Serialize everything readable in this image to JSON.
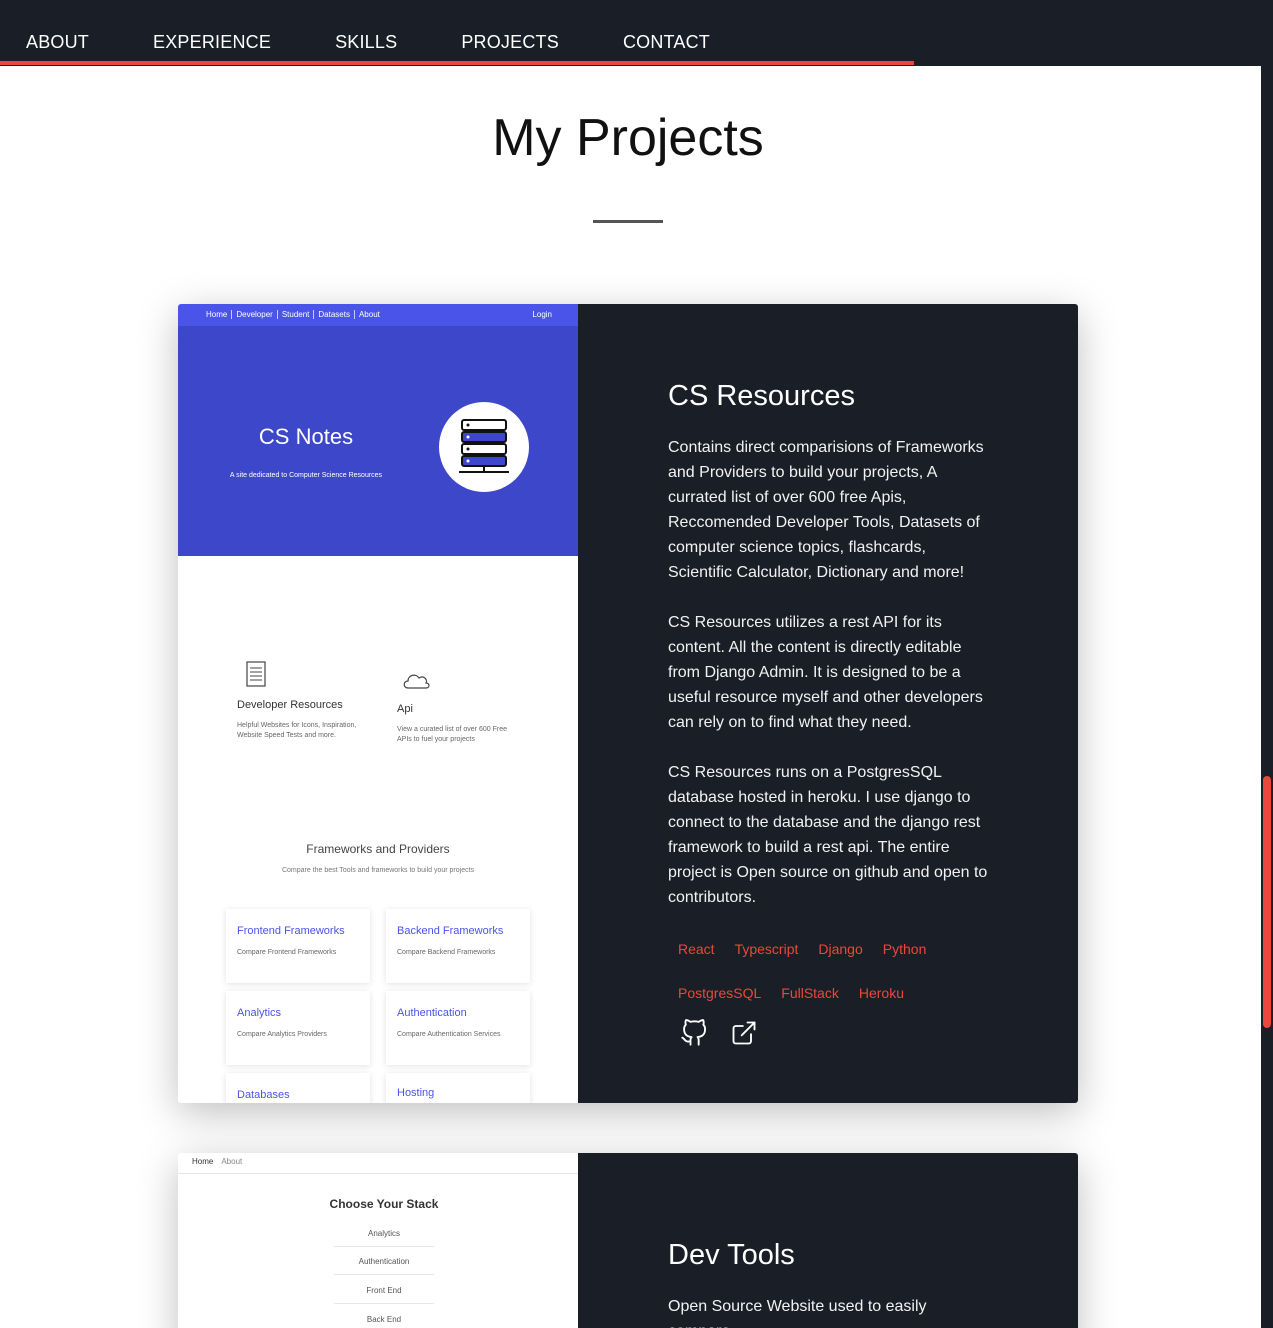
{
  "nav": {
    "links": [
      "ABOUT",
      "EXPERIENCE",
      "SKILLS",
      "PROJECTS",
      "CONTACT"
    ]
  },
  "section": {
    "title": "My Projects"
  },
  "projects": [
    {
      "title": "CS Resources",
      "description": [
        "Contains direct comparisions of Frameworks and Providers to build your projects, A currated list of over 600 free Apis, Reccomended Developer Tools, Datasets of computer science topics, flashcards, Scientific Calculator, Dictionary and more!",
        "CS Resources utilizes a rest API for its content. All the content is directly editable from Django Admin. It is designed to be a useful resource myself and other developers can rely on to find what they need.",
        "CS Resources runs on a PostgresSQL database hosted in heroku. I use django to connect to the database and the django rest framework to build a rest api. The entire project is Open source on github and open to contributors."
      ],
      "tags": [
        "React",
        "Typescript",
        "Django",
        "Python",
        "PostgresSQL",
        "FullStack",
        "Heroku"
      ],
      "icons": [
        "github-icon",
        "external-link-icon"
      ],
      "screenshot": {
        "nav_links": [
          "Home",
          "Developer",
          "Student",
          "Datasets",
          "About"
        ],
        "login": "Login",
        "hero_title": "CS Notes",
        "hero_subtitle": "A site dedicated to Computer Science Resources",
        "features": [
          {
            "title": "Developer Resources",
            "text": "Helpful Websites for Icons, Inspiration, Website Speed Tests and more."
          },
          {
            "title": "Api",
            "text": "View a curated list of over 600 Free APIs to fuel your projects"
          }
        ],
        "fw_title": "Frameworks and Providers",
        "fw_subtitle": "Compare the best Tools and frameworks to build your projects",
        "boxes": [
          {
            "title": "Frontend Frameworks",
            "text": "Compare Frontend Frameworks"
          },
          {
            "title": "Backend Frameworks",
            "text": "Compare Backend Frameworks"
          },
          {
            "title": "Analytics",
            "text": "Compare Analytics Providers"
          },
          {
            "title": "Authentication",
            "text": "Compare Authentication Services"
          },
          {
            "title": "Databases",
            "text": ""
          },
          {
            "title": "Hosting",
            "text": ""
          }
        ]
      }
    },
    {
      "title": "Dev Tools",
      "description": [
        "Open Source Website used to easily compare"
      ],
      "screenshot": {
        "nav_links": [
          "Home",
          "About"
        ],
        "title": "Choose Your Stack",
        "items": [
          "Analytics",
          "Authentication",
          "Front End",
          "Back End"
        ]
      }
    }
  ],
  "colors": {
    "nav_bg": "#1a1f27",
    "accent": "#e8493a",
    "mock_blue": "#3d47c9"
  }
}
